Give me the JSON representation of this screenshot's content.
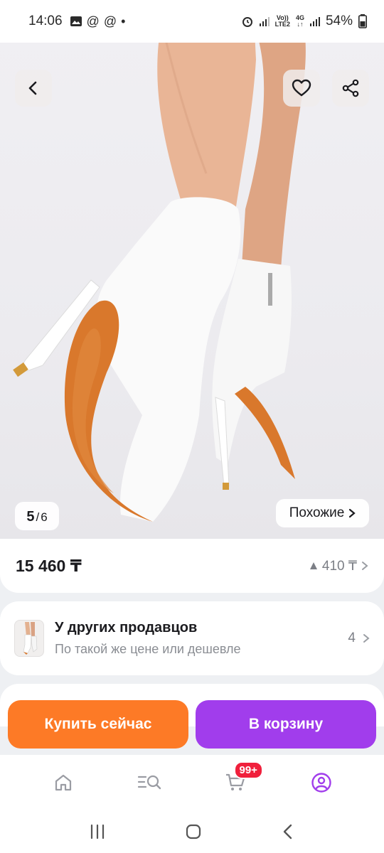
{
  "status_bar": {
    "time": "14:06",
    "network_top": "Vo))",
    "network_bottom": "LTE2",
    "network_4g": "4G",
    "battery": "54%"
  },
  "gallery": {
    "current": "5",
    "separator": "/",
    "total": "6",
    "similar_label": "Похожие"
  },
  "price": {
    "value": "15 460 ₸",
    "change": "410 ₸"
  },
  "other_sellers": {
    "title": "У других продавцов",
    "subtitle": "По такой же цене или дешевле",
    "count": "4"
  },
  "actions": {
    "buy_now": "Купить сейчас",
    "add_to_cart": "В корзину"
  },
  "nav": {
    "cart_badge": "99+"
  },
  "colors": {
    "buy": "#fd7a26",
    "cart": "#a13dec",
    "badge": "#f0203c",
    "profile_active": "#a13dec"
  }
}
